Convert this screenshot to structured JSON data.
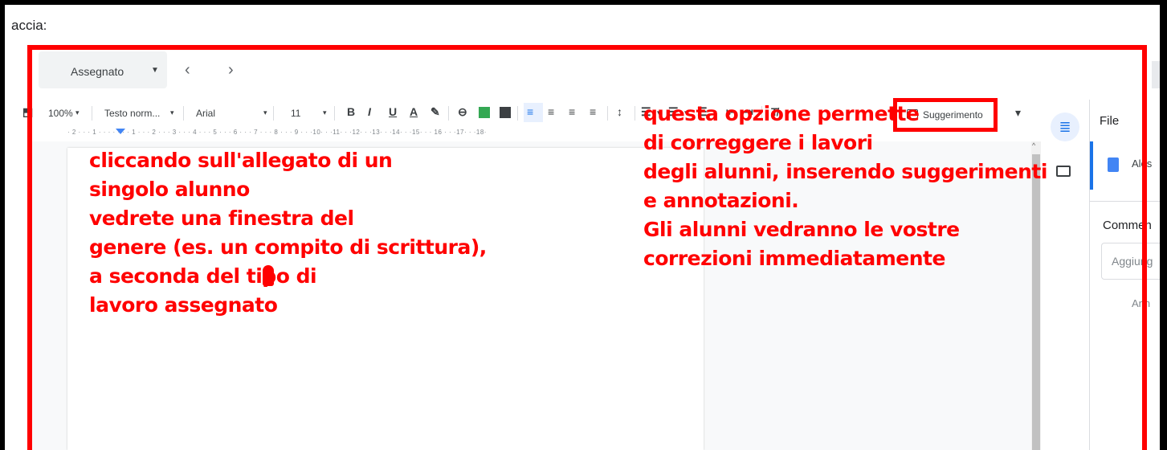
{
  "caption": "accia:",
  "header": {
    "assign_label": "Assegnato",
    "caret": "▼",
    "prev": "‹",
    "next": "›"
  },
  "toolbar": {
    "paint_format": "⬒",
    "zoom": "100%",
    "style": "Testo norm...",
    "font": "Arial",
    "size": "11",
    "bold": "B",
    "italic": "I",
    "underline": "U",
    "text_color": "A",
    "suggest_label": "Suggerimento",
    "dropdown": "▾"
  },
  "ruler": "· 2 · · · 1 · · · · · · · 1 · · · 2 · · · 3 · · · 4 · · · 5 · · · 6 · · · 7 · · · 8 · · · 9 · · ·10· · ·11· · ·12· · ·13· · ·14· · ·15· · · 16 · · ·17· · ·18·",
  "side_panel": {
    "title": "File",
    "file_name": "Ales",
    "comments_title": "Commen",
    "comment_placeholder": "Aggiung",
    "cancel": "Ann"
  },
  "annotations": {
    "left": [
      "cliccando sull'allegato di un",
      "singolo alunno",
      "vedrete una finestra del",
      "genere (es. un compito di scrittura),",
      "a seconda del tipo di",
      "lavoro assegnato"
    ],
    "right": [
      "questa opzione permette",
      "di correggere i lavori",
      "degli alunni, inserendo suggerimenti",
      "e annotazioni.",
      "Gli alunni vedranno le vostre",
      "correzioni immediatamente"
    ]
  },
  "colors": {
    "annotation": "#ff0000",
    "accent": "#1a73e8"
  },
  "icons": [
    "paint-format-icon",
    "link-icon",
    "image-icon",
    "align-icons",
    "clear-format-icon",
    "suggest-icon",
    "files-icon",
    "comment-icon",
    "doc-file-icon"
  ]
}
